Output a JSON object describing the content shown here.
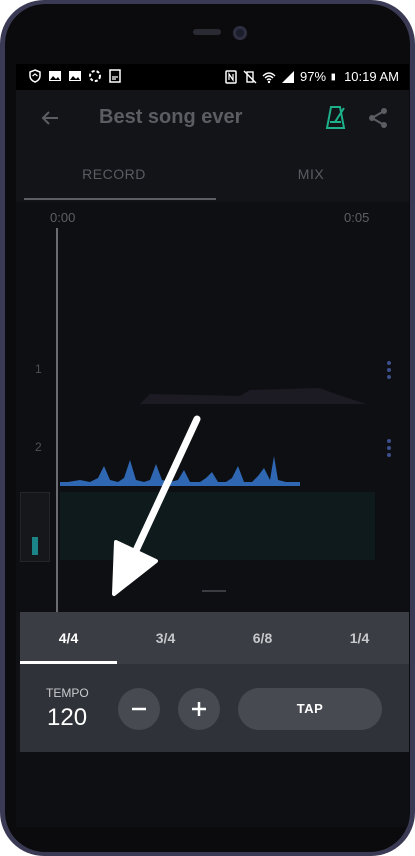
{
  "status_bar": {
    "battery": "97%",
    "time": "10:19 AM"
  },
  "app_bar": {
    "title": "Best song ever",
    "icons": [
      "back-arrow-icon",
      "metronome-icon",
      "share-icon"
    ]
  },
  "tabs": [
    {
      "label": "RECORD",
      "selected": true
    },
    {
      "label": "MIX",
      "selected": false
    }
  ],
  "timeline": {
    "start": "0:00",
    "end": "0:05",
    "tracks": [
      {
        "number": "1"
      },
      {
        "number": "2"
      }
    ]
  },
  "time_signatures": [
    {
      "label": "4/4",
      "selected": true
    },
    {
      "label": "3/4",
      "selected": false
    },
    {
      "label": "6/8",
      "selected": false
    },
    {
      "label": "1/4",
      "selected": false
    }
  ],
  "tempo": {
    "label": "TEMPO",
    "value": "120",
    "tap_label": "TAP"
  },
  "colors": {
    "accent": "#1db08a",
    "waveform_track2": "#2f67b3",
    "panel": "#2f3238"
  }
}
